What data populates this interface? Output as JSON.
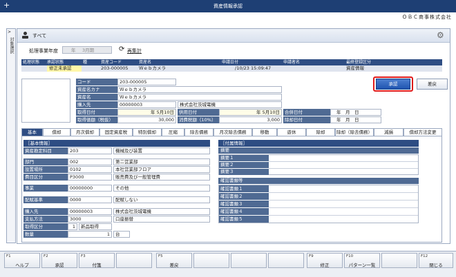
{
  "window": {
    "title": "資産情報承認",
    "plus": "+",
    "company": "ＯＢＣ商事株式会社"
  },
  "side_tab": "対象選択",
  "header": {
    "title": "すべて"
  },
  "filter": {
    "label": "処理事業年度",
    "year_value": "年",
    "month_value": "3月期",
    "refresh_label": "再集計"
  },
  "grid": {
    "columns": [
      "処理状態",
      "承認状態",
      "種",
      "資産コード",
      "資産名",
      "申請日付",
      "申請者名",
      "最終登録区分"
    ],
    "row": {
      "status": "修正未承認",
      "code": "203-000005",
      "name": "Ｗｅｂカメラ",
      "date": "/10/23 15:09:47",
      "last_reg": "資産情報"
    }
  },
  "buttons": {
    "approve": "承認",
    "reject": "差戻"
  },
  "detail": {
    "code_label": "コード",
    "code": "203-000005",
    "kana_label": "資産名カナ",
    "kana": "Ｗｅｂカメラ",
    "name_label": "資産名",
    "name": "Ｗｅｂカメラ",
    "vendor_label": "購入先",
    "vendor_code": "00000003",
    "vendor_name": "株式会社茨城電機",
    "acq_date_label": "取得日付",
    "acq_date": "年 5月10日",
    "use_date_label": "供用日付",
    "use_date": "年 5月10日",
    "merge_date_label": "合併日付",
    "merge_date": "年　月　日",
    "cost_label": "取得価額（税抜）",
    "cost": "30,000",
    "tax_label": "消費税額（10%）",
    "tax": "3,000",
    "remove_date_label": "除却日付",
    "remove_date": "年　月　日"
  },
  "tabs": [
    "基本",
    "償却",
    "月次償却",
    "固定資産税",
    "特別償却",
    "圧縮",
    "除去債務",
    "月次除去債務",
    "移動",
    "遊休",
    "除却",
    "除却（除去債務）",
    "減損",
    "償却方法変更"
  ],
  "basic": {
    "section": "［基本情報］",
    "rows": [
      {
        "label": "資産勘定科目",
        "code": "203",
        "value": "機械及び装置"
      },
      {
        "label": "部門",
        "code": "002",
        "value": "第二営業部"
      },
      {
        "label": "設置場所",
        "code": "0102",
        "value": "本社営業部フロア"
      },
      {
        "label": "費目区分",
        "code": "P3000",
        "value": "販売費及び一般管理費"
      },
      {
        "label": "事業",
        "code": "00000000",
        "value": "その他"
      },
      {
        "label": "配賦基準",
        "code": "0000",
        "value": "配賦しない"
      },
      {
        "label": "購入先",
        "code": "00000003",
        "value": "株式会社茨城電機"
      },
      {
        "label": "支払方法",
        "code": "3000",
        "value": "口座振替"
      },
      {
        "label": "取得区分",
        "code": "1",
        "value": "新品取得"
      },
      {
        "label": "数量",
        "code": "1",
        "value": "台"
      }
    ]
  },
  "extra": {
    "section": "［付属情報］",
    "summary_header": "摘要",
    "summary_rows": [
      "摘要１",
      "摘要２",
      "摘要３"
    ],
    "doc_header": "確認書類等",
    "doc_rows": [
      "確認書類１",
      "確認書類２",
      "確認書類３",
      "確認書類４",
      "確認書類５"
    ]
  },
  "fkeys": [
    {
      "key": "F1",
      "name": "ヘルプ"
    },
    {
      "key": "F2",
      "name": "承認"
    },
    {
      "key": "F3",
      "name": "付箋"
    },
    {
      "key": "",
      "name": ""
    },
    {
      "key": "F5",
      "name": "差戻"
    },
    {
      "key": "",
      "name": ""
    },
    {
      "key": "",
      "name": ""
    },
    {
      "key": "",
      "name": ""
    },
    {
      "key": "F9",
      "name": "修正"
    },
    {
      "key": "F10",
      "name": "パターン一覧"
    },
    {
      "key": "",
      "name": ""
    },
    {
      "key": "F12",
      "name": "閉じる"
    }
  ]
}
